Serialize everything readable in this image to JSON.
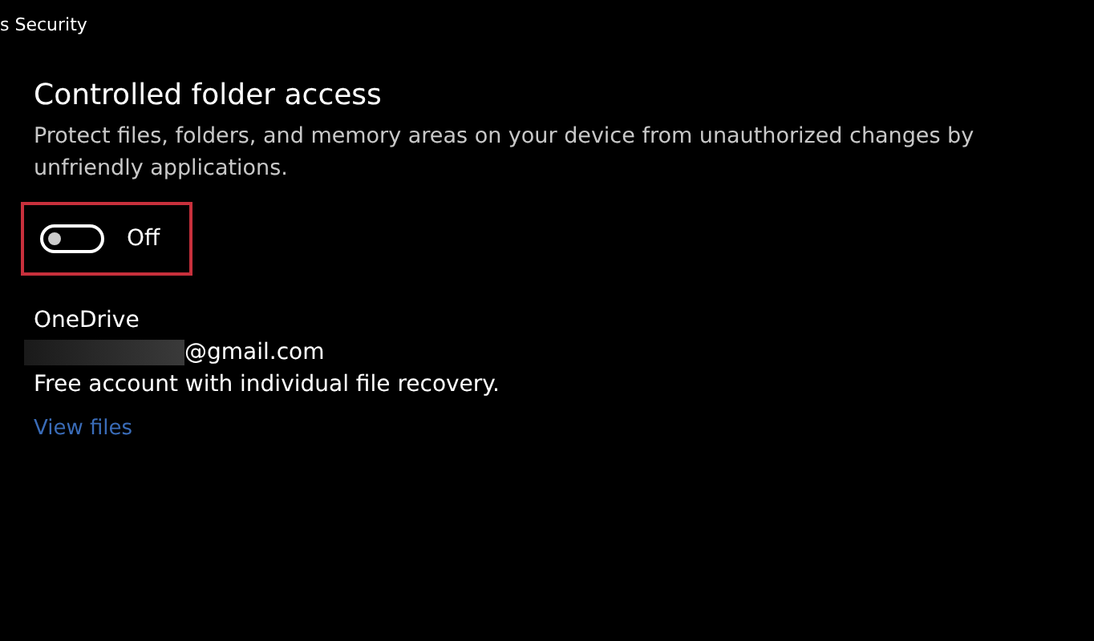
{
  "window": {
    "title": "s Security"
  },
  "section": {
    "heading": "Controlled folder access",
    "description": "Protect files, folders, and memory areas on your device from unauthorized changes by unfriendly applications.",
    "toggle": {
      "on": false,
      "label": "Off",
      "highlighted": true
    }
  },
  "account": {
    "provider": "OneDrive",
    "email": "@gmail.com",
    "email_redacted": true,
    "plan": "Free account with individual file recovery.",
    "link": "View files"
  }
}
